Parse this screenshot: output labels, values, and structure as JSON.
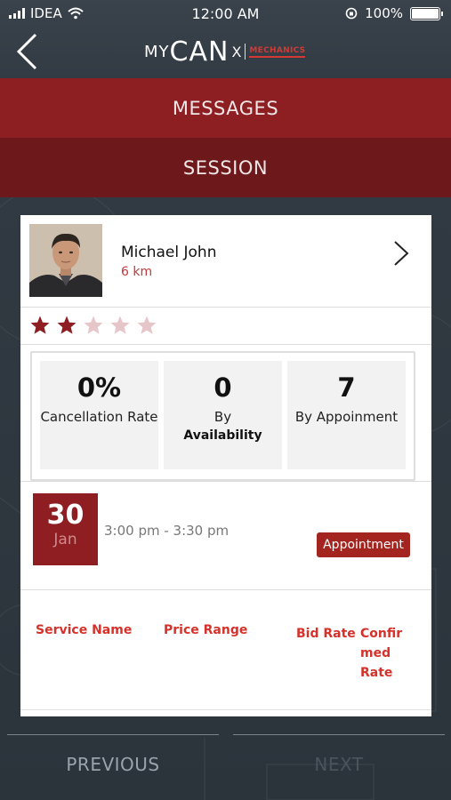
{
  "status_bar": {
    "carrier": "IDEA",
    "time": "12:00 AM",
    "battery": "100%"
  },
  "header": {
    "logo_my": "MY",
    "logo_can": "CAN",
    "logo_x": "X",
    "logo_tag": "MECHANICS"
  },
  "tabs": [
    {
      "label": "MESSAGES"
    },
    {
      "label": "SESSION"
    }
  ],
  "profile": {
    "name": "Michael John",
    "distance": "6 km",
    "rating": 2,
    "rating_max": 5
  },
  "stats": [
    {
      "value": "0%",
      "label": "Cancellation Rate",
      "sublabel": ""
    },
    {
      "value": "0",
      "label": "By",
      "sublabel": "Availability"
    },
    {
      "value": "7",
      "label": "By Appoinment",
      "sublabel": ""
    }
  ],
  "session": {
    "day": "30",
    "month": "Jan",
    "time_range": "3:00 pm - 3:30 pm",
    "type_label": "Appointment"
  },
  "table_headers": {
    "service_name": "Service Name",
    "price_range": "Price Range",
    "bid_rate": "Bid Rate",
    "confirmed_rate": "Confir med Rate"
  },
  "bottom_nav": {
    "previous": "PREVIOUS",
    "next": "NEXT"
  },
  "colors": {
    "tab_messages": "#8d1e22",
    "tab_session": "#6d191c",
    "accent_red": "#d6312a",
    "star_filled": "#8f1e22",
    "star_empty": "#e6c6c8"
  }
}
